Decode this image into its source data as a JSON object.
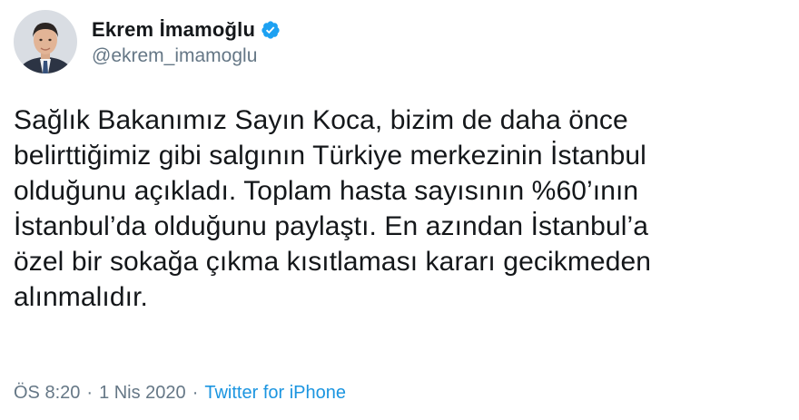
{
  "author": {
    "display_name": "Ekrem İmamoğlu",
    "handle": "@ekrem_imamoglu",
    "verified": true,
    "avatar_icon": "profile-photo",
    "verified_icon": "verified-badge-icon"
  },
  "tweet": {
    "text": "Sağlık Bakanımız Sayın Koca, bizim de daha önce\nbelirttiğimiz gibi salgının Türkiye merkezinin İstanbul\nolduğunu açıkladı. Toplam hasta sayısının %60’ının\nİstanbul’da olduğunu paylaştı. En azından İstanbul’a\nözel bir sokağa çıkma kısıtlaması kararı gecikmeden\nalınmalıdır."
  },
  "meta": {
    "time": "ÖS 8:20",
    "separator": "·",
    "date": "1 Nis 2020",
    "source": "Twitter for iPhone"
  },
  "colors": {
    "text": "#14171a",
    "secondary": "#657786",
    "link": "#1b95e0",
    "verified": "#1da1f2"
  }
}
